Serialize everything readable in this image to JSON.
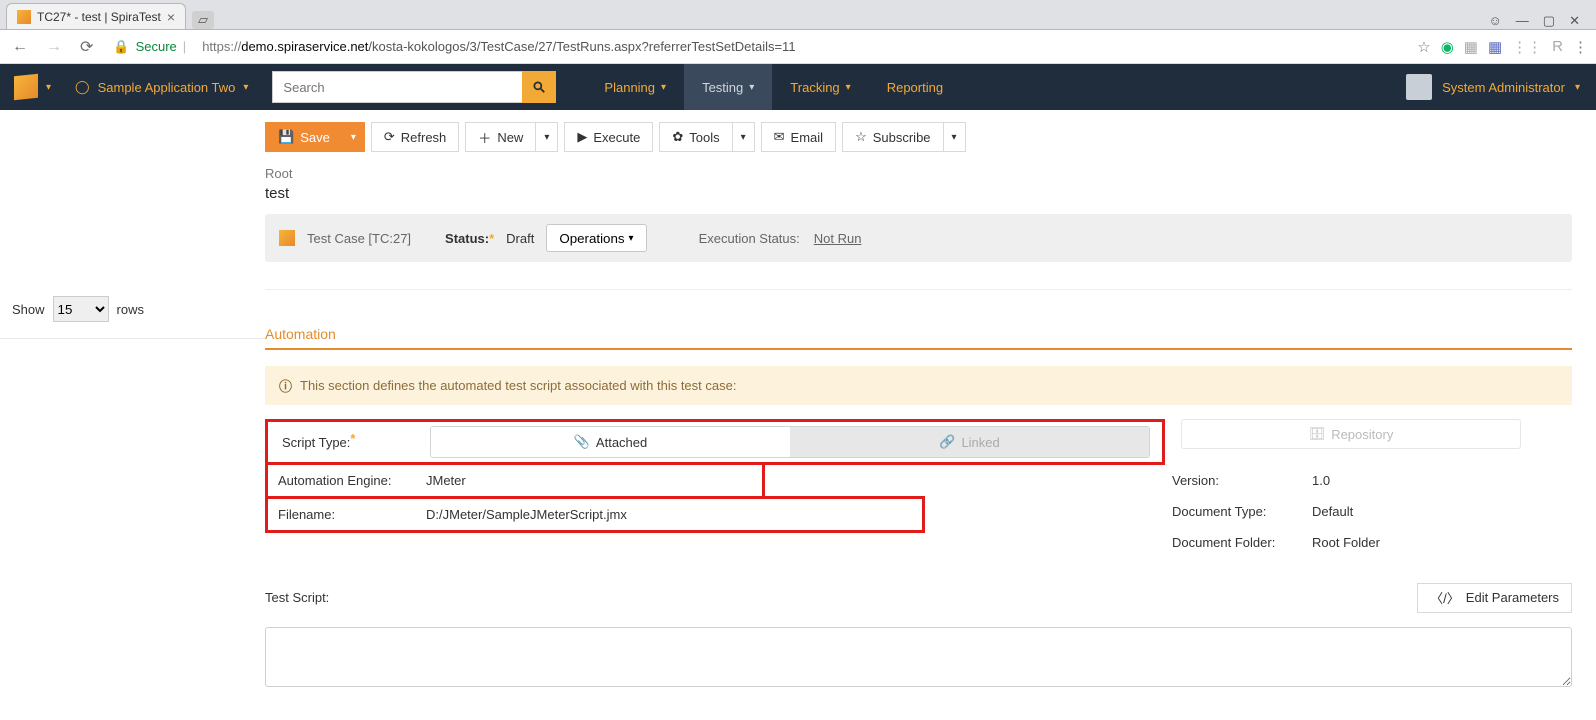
{
  "browser": {
    "tab_title": "TC27* - test | SpiraTest",
    "secure_label": "Secure",
    "url_prefix": "https://",
    "url_host": "demo.spiraservice.net",
    "url_path": "/kosta-kokologos/3/TestCase/27/TestRuns.aspx?referrerTestSetDetails=11"
  },
  "nav": {
    "project": "Sample Application Two",
    "search_placeholder": "Search",
    "menu": {
      "planning": "Planning",
      "testing": "Testing",
      "tracking": "Tracking",
      "reporting": "Reporting"
    },
    "user": "System Administrator"
  },
  "toolbar": {
    "save": "Save",
    "refresh": "Refresh",
    "new": "New",
    "execute": "Execute",
    "tools": "Tools",
    "email": "Email",
    "subscribe": "Subscribe"
  },
  "breadcrumb": {
    "root": "Root"
  },
  "title": "test",
  "status_bar": {
    "item": "Test Case [TC:27]",
    "status_label": "Status:",
    "status_value": "Draft",
    "operations": "Operations",
    "exec_label": "Execution Status:",
    "exec_value": "Not Run"
  },
  "rows_ctrl": {
    "show": "Show",
    "count": "15",
    "rows": "rows"
  },
  "section": {
    "heading": "Automation",
    "info": "This section defines the automated test script associated with this test case:",
    "script_type_label": "Script Type:",
    "attached": "Attached",
    "linked": "Linked",
    "repository": "Repository",
    "engine_label": "Automation Engine:",
    "engine_value": "JMeter",
    "filename_label": "Filename:",
    "filename_value": "D:/JMeter/SampleJMeterScript.jmx",
    "version_label": "Version:",
    "version_value": "1.0",
    "doctype_label": "Document Type:",
    "doctype_value": "Default",
    "docfolder_label": "Document Folder:",
    "docfolder_value": "Root Folder",
    "script_label": "Test Script:",
    "edit_params": "Edit Parameters"
  }
}
